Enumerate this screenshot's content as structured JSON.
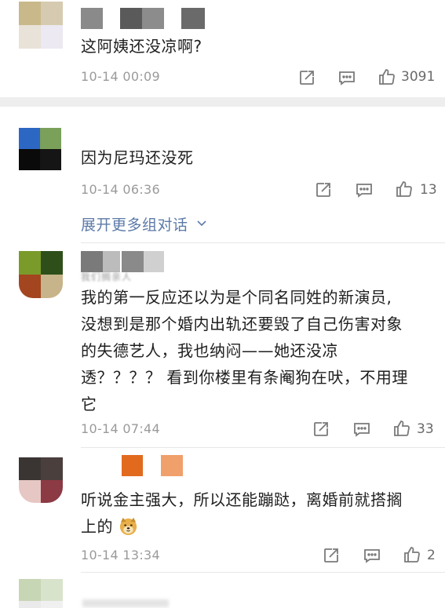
{
  "comments": [
    {
      "text": "这阿姨还没凉啊?",
      "time": "10-14 00:09",
      "likes": "3091",
      "avatar_colors": [
        "#c9b98a",
        "#d6cbb0",
        "#e8e2d8",
        "#ece9f2"
      ],
      "name_blocks": [
        "#8a8a8a",
        "#5a5a5a",
        "#8c8c8c",
        "#6a6a6a"
      ]
    },
    {
      "text": "因为尼玛还没死",
      "time": "10-14 06:36",
      "likes": "13",
      "avatar_colors": [
        "#2d67c4",
        "#7aa05a",
        "#0a0a0a",
        "#151515"
      ]
    },
    {
      "more_label": "展开更多组对话"
    },
    {
      "text_lines": [
        "我的第一反应还以为是个同名同姓的新演员,",
        "没想到是那个婚内出轨还要毁了自己伤害对象",
        "的失德艺人，我也纳闷——她还没凉",
        "透？？？？ 看到你楼里有条阉狗在吠，不用理",
        "它"
      ],
      "time": "10-14 07:44",
      "likes": "33",
      "avatar_colors": [
        "#7a9a2a",
        "#2f4f1a",
        "#a3461f",
        "#c8b48a"
      ],
      "name_blocks": [
        "#7a7a7a",
        "#bcbcbc",
        "#8a8a8a",
        "#d0d0d0"
      ],
      "name_blur_text": "我们搁亲人"
    },
    {
      "text_lines": [
        "听说金主强大，所以还能蹦跶，离婚前就搭搁",
        "上的"
      ],
      "time": "10-14 13:34",
      "likes": "2",
      "avatar_colors": [
        "#3a3533",
        "#4a3f3d",
        "#e6c7c4",
        "#8c3a44"
      ],
      "name_blocks": [
        "#e26a1e",
        "#f0a06a"
      ]
    },
    {
      "avatar_colors": [
        "#c7d6b4",
        "#d8e3cc",
        "#eaeaea",
        "#f0f0f0"
      ]
    }
  ],
  "icons": {
    "share": "share-icon",
    "comment": "comment-icon",
    "like": "thumbs-up-icon",
    "chevron": "chevron-down-icon",
    "emoji": "doge-emoji-icon"
  },
  "colors": {
    "link": "#5c7aa8",
    "time": "#9a9a9a",
    "divider": "#eeeeee"
  }
}
